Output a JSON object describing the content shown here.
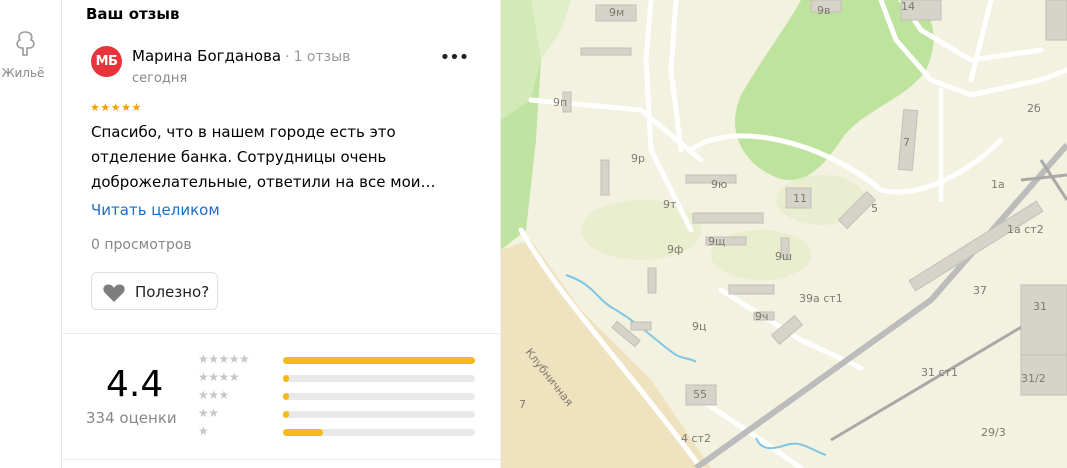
{
  "sidebar": {
    "housing_label": "Жильё"
  },
  "review": {
    "section_title": "Ваш отзыв",
    "avatar_initials": "МБ",
    "avatar_color": "#e8333b",
    "author": "Марина Богданова",
    "author_reviews": "1 отзыв",
    "date": "сегодня",
    "stars": "★★★★★",
    "text": "Спасибо, что в нашем городе есть это отделение банка. Сотрудницы очень доброжелательные, ответили на все мои…",
    "read_more": "Читать целиком",
    "views": "0 просмотров",
    "useful_label": "Полезно?"
  },
  "rating": {
    "value": "4.4",
    "count_label": "334 оценки",
    "distribution": [
      {
        "stars": "★★★★★",
        "fraction": 1.0
      },
      {
        "stars": "★★★★",
        "fraction": 0.03
      },
      {
        "stars": "★★★",
        "fraction": 0.03
      },
      {
        "stars": "★★",
        "fraction": 0.03
      },
      {
        "stars": "★",
        "fraction": 0.21
      }
    ],
    "bar_color": "#f6b91a"
  },
  "map": {
    "labels": [
      "9м",
      "9в",
      "14",
      "9п",
      "2б",
      "7",
      "9р",
      "9ю",
      "11",
      "1а",
      "5",
      "9т",
      "9щ",
      "1а ст2",
      "9ф",
      "9ш",
      "39а ст1",
      "37",
      "31",
      "9ч",
      "9ц",
      "Клубничная",
      "31 ст1",
      "31/2",
      "55",
      "7",
      "4 ст2",
      "29/3"
    ]
  }
}
